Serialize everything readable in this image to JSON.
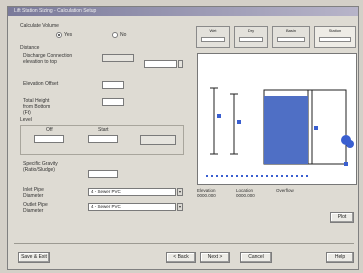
{
  "window": {
    "title": "Lift Station Sizing - Calculation Setup"
  },
  "calc_method": {
    "label": "Calculate Volume",
    "options": [
      {
        "label": "Yes",
        "selected": true
      },
      {
        "label": "No",
        "selected": false
      }
    ]
  },
  "distance": {
    "label": "Distance",
    "fields": [
      {
        "label": "Discharge Connection elevation to top",
        "value": "",
        "extra_value": "",
        "read_only": true
      },
      {
        "label": "Elevation Offset",
        "value": "",
        "read_only": false
      },
      {
        "label": "Total Height from Bottom (Ft)",
        "value": "",
        "read_only": false
      }
    ]
  },
  "levels": {
    "label": "Level",
    "col_labels": [
      "Off",
      "Start"
    ],
    "values": [
      "",
      ""
    ],
    "result": ""
  },
  "specific_gravity": {
    "label": "Specific Gravity (Ratio/Sludge)",
    "value": ""
  },
  "pipes": [
    {
      "label": "Inlet Pipe Diameter",
      "value": "4 - Sewer PVC"
    },
    {
      "label": "Outlet Pipe Diameter",
      "value": "4 - Sewer PVC"
    }
  ],
  "tabs": [
    {
      "label": "Wet"
    },
    {
      "label": "Dry"
    },
    {
      "label": "Basin"
    },
    {
      "label": "Station"
    }
  ],
  "diagram": {
    "legend": [
      {
        "line1": "Elevation",
        "line2": "0000.000"
      },
      {
        "line1": "Location",
        "line2": "0000.000"
      },
      {
        "line1": "Overflow",
        "line2": ""
      }
    ],
    "colors": {
      "water": "#4f6fc5",
      "outline": "#222222",
      "pump": "#3a5fd0"
    }
  },
  "buttons": {
    "plot": "Plot",
    "save_exit": "Save & Exit",
    "back": "< Back",
    "next": "Next >",
    "cancel": "Cancel",
    "help": "Help"
  }
}
